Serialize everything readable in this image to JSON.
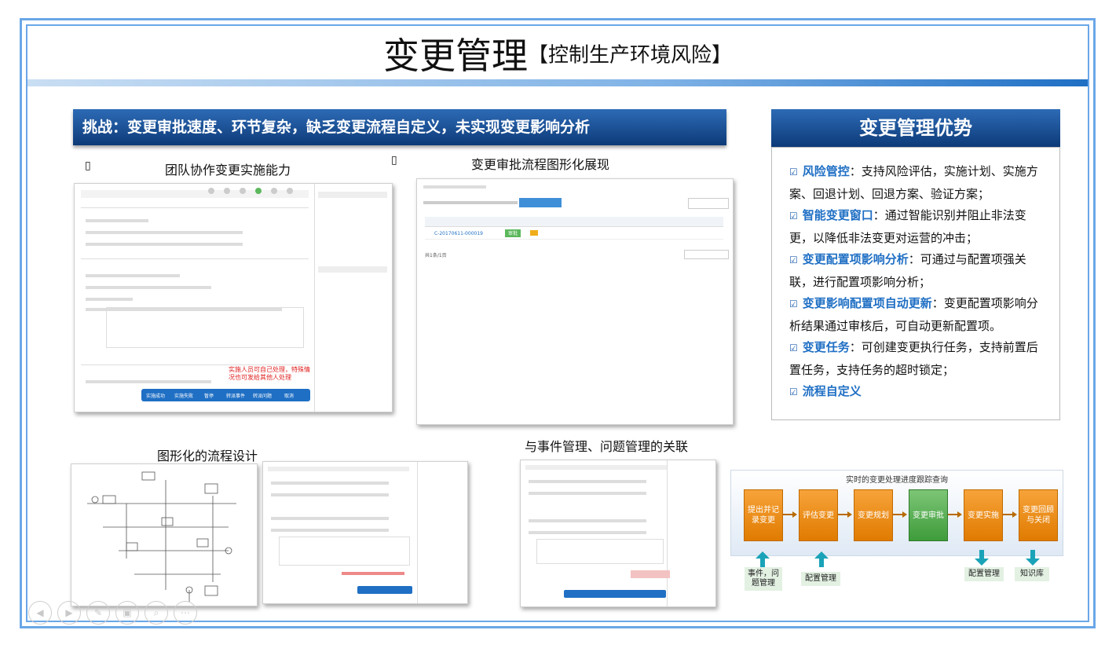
{
  "title": {
    "main": "变更管理",
    "sub": "【控制生产环境风险】"
  },
  "challenge": "挑战：变更审批速度、环节复杂，缺乏变更流程自定义，未实现变更影响分析",
  "captions": {
    "team": "团队协作变更实施能力",
    "approval_flow": "变更审批流程图形化展现",
    "flow_design": "图形化的流程设计",
    "relation": "与事件管理、问题管理的关联",
    "bullet_glyph": "▯"
  },
  "shot1": {
    "annotation": "实施人员可自己处理，特殊情况也可发给其他人处理",
    "buttons": [
      "实施成功",
      "实施失败",
      "暂停",
      "转派事件",
      "转派问题",
      "取消"
    ]
  },
  "shot2": {
    "row": {
      "id": "C-20170611-000019",
      "action_btn": "审批"
    },
    "pager": "共1条/1页"
  },
  "advantages": {
    "header": "变更管理优势",
    "items": [
      {
        "keyword": "风险管控",
        "text": "：支持风险评估，实施计划、实施方案、回退计划、回退方案、验证方案；"
      },
      {
        "keyword": "智能变更窗口",
        "text": "：通过智能识别并阻止非法变更，以降低非法变更对运营的冲击；"
      },
      {
        "keyword": "变更配置项影响分析",
        "text": "：可通过与配置项强关联，进行配置项影响分析；"
      },
      {
        "keyword": "变更影响配置项自动更新",
        "text": "：变更配置项影响分析结果通过审核后，可自动更新配置项。"
      },
      {
        "keyword": "变更任务",
        "text": "：可创建变更执行任务，支持前置后置任务，支持任务的超时锁定；"
      },
      {
        "keyword": "流程自定义",
        "text": ""
      }
    ]
  },
  "flow": {
    "title": "实时的变更处理进度跟踪查询",
    "steps": [
      "提出并记录变更",
      "评估变更",
      "变更规划",
      "变更审批",
      "变更实施",
      "变更回顾与关闭"
    ],
    "highlight_step": 3,
    "inputs": [
      "事件，问题管理",
      "配置管理"
    ],
    "outputs": [
      "配置管理",
      "知识库"
    ]
  },
  "toolbar": [
    "prev-icon",
    "next-icon",
    "pen-icon",
    "screen-icon",
    "zoom-icon",
    "more-icon"
  ],
  "colors": {
    "header_blue": "#0d3a78",
    "accent_blue": "#1f6fc4",
    "orange": "#e07b00",
    "green": "#3e9c3a"
  }
}
